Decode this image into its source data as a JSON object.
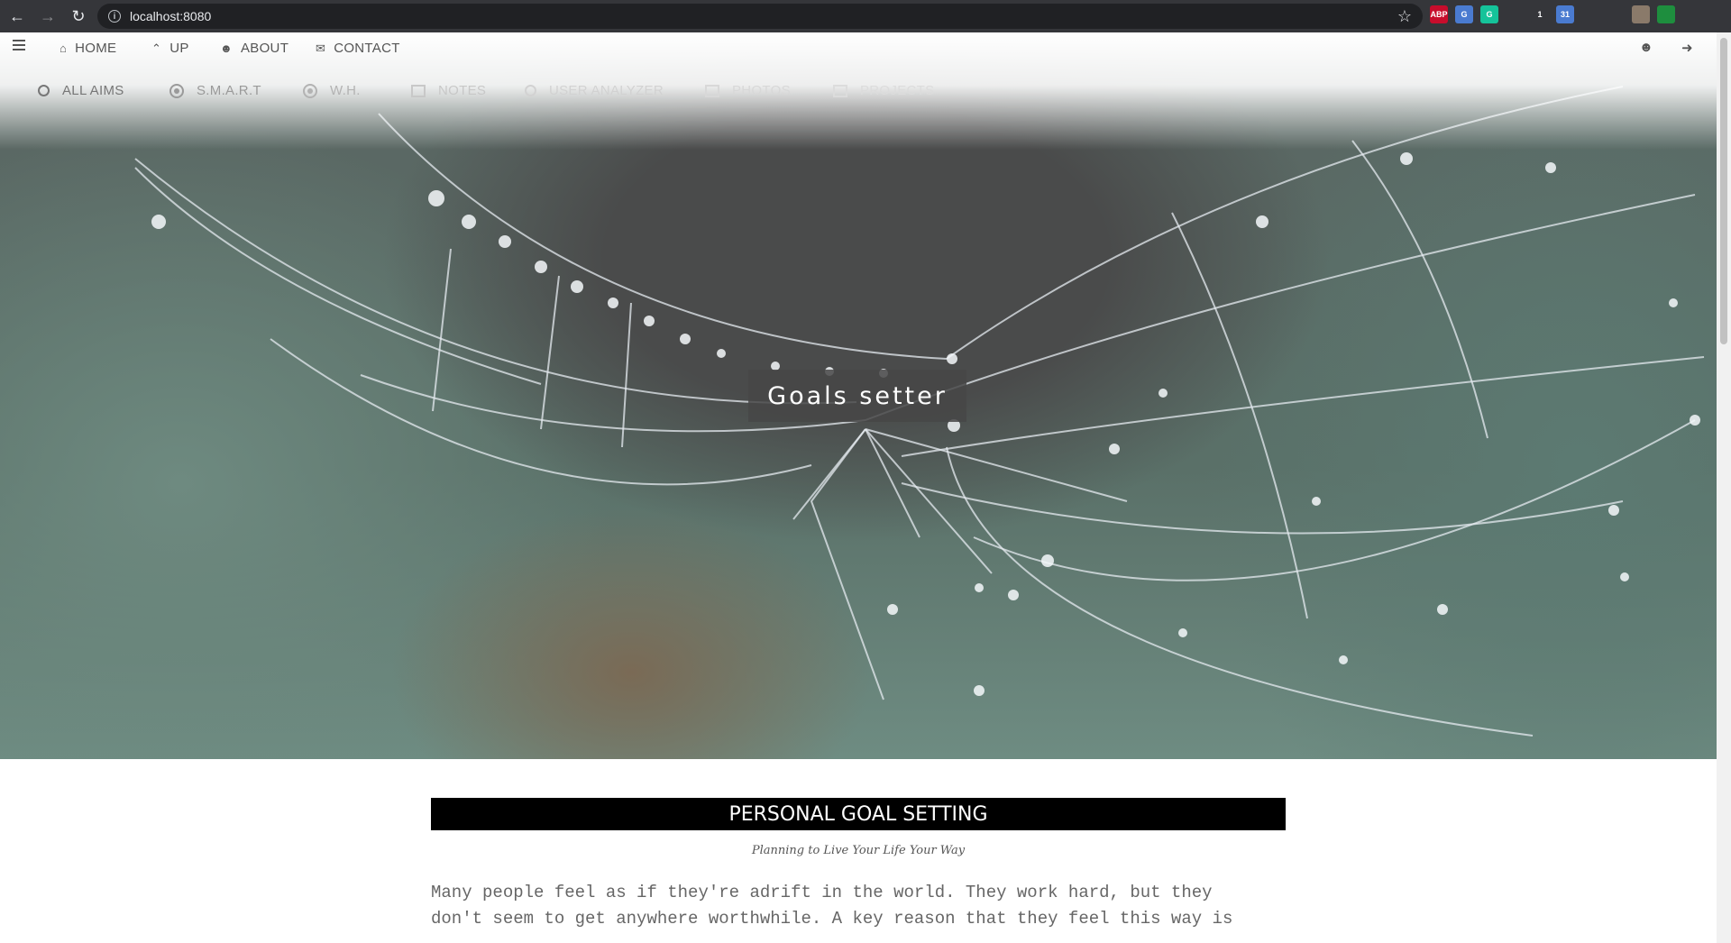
{
  "browser": {
    "url": "localhost:8080",
    "extensions": [
      {
        "name": "adblock-plus-icon",
        "label": "ABP",
        "color": "#c70d2c"
      },
      {
        "name": "translate-icon",
        "label": "G",
        "color": "#4a7bd0"
      },
      {
        "name": "grammarly-icon",
        "label": "G",
        "color": "#15c39a"
      },
      {
        "name": "diamond-icon",
        "label": "",
        "color": "#35363a"
      },
      {
        "name": "ghost-icon",
        "label": "1",
        "color": "#35363a"
      },
      {
        "name": "calendar-icon",
        "label": "31",
        "color": "#4a7bd0"
      },
      {
        "name": "mask-icon",
        "label": "",
        "color": "#35363a"
      },
      {
        "name": "reading-list-icon",
        "label": "",
        "color": "#35363a"
      },
      {
        "name": "profile-avatar-icon",
        "label": "",
        "color": "#8a7a6a"
      },
      {
        "name": "update-icon",
        "label": "",
        "color": "#1e8e3e"
      }
    ]
  },
  "nav": {
    "home": "HOME",
    "up": "UP",
    "about": "ABOUT",
    "contact": "CONTACT"
  },
  "subnav": {
    "all_aims": "ALL AIMS",
    "smart": "S.M.A.R.T",
    "wh": "W.H.",
    "notes": "NOTES",
    "user_analyzer": "USER ANALYZER",
    "photos": "PHOTOS",
    "projects": "PROJECTS"
  },
  "hero": {
    "title": "Goals setter"
  },
  "content": {
    "heading": "PERSONAL GOAL SETTING",
    "subtitle": "Planning to Live Your Life Your Way",
    "paragraph_line1": "Many people feel as if they're adrift in the world. They work hard, but they",
    "paragraph_line2": "don't seem to get anywhere worthwhile. A key reason that they feel this way is"
  },
  "colors": {
    "accent_bar": "#000000",
    "nav_text": "#555555",
    "body_text": "#666666"
  }
}
